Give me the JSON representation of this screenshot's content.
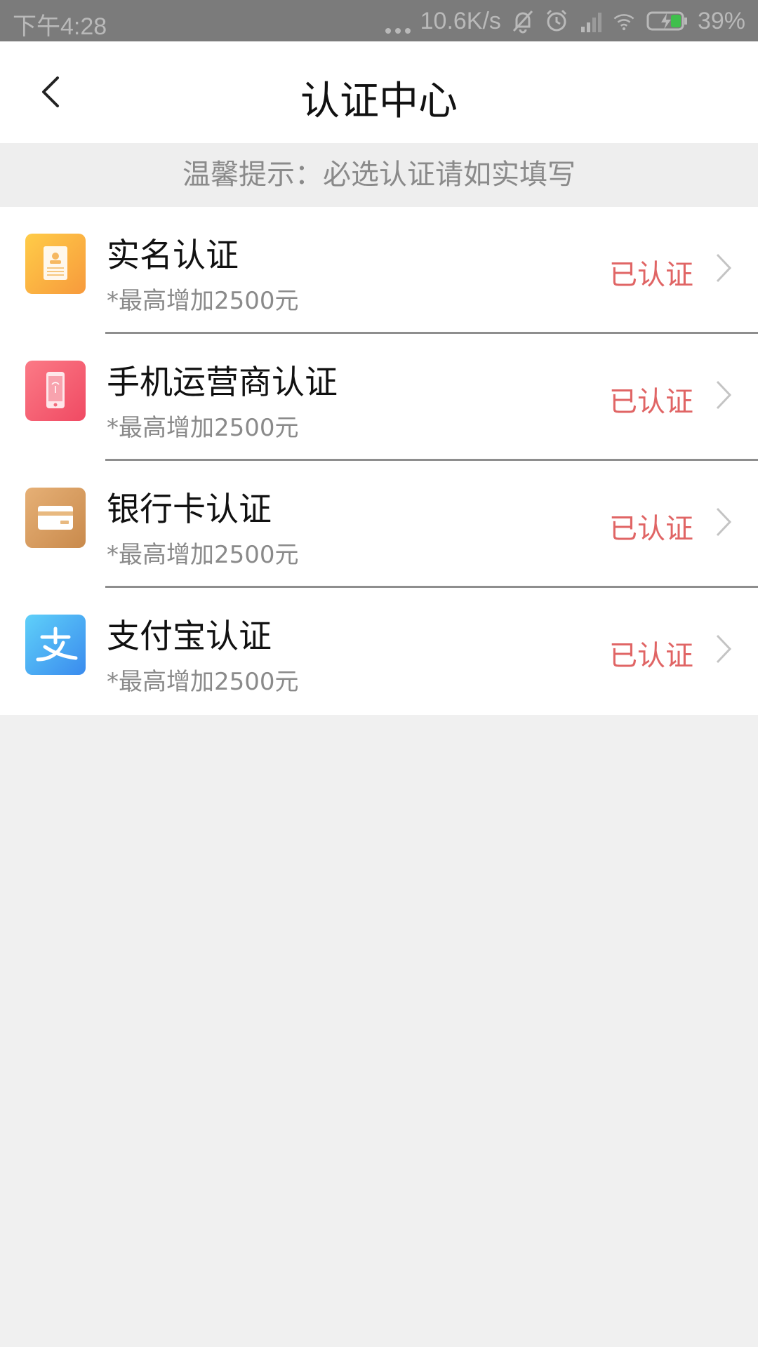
{
  "status_bar": {
    "time": "下午4:28",
    "network_speed": "10.6K/s",
    "battery": "39%"
  },
  "header": {
    "title": "认证中心"
  },
  "tip": {
    "text": "温馨提示：必选认证请如实填写"
  },
  "items": [
    {
      "title": "实名认证",
      "subtitle": "*最高增加2500元",
      "status": "已认证",
      "icon": "id-card-icon",
      "icon_colors": [
        "#ffcc48",
        "#f79a3c"
      ]
    },
    {
      "title": "手机运营商认证",
      "subtitle": "*最高增加2500元",
      "status": "已认证",
      "icon": "mobile-phone-icon",
      "icon_colors": [
        "#fb7a86",
        "#f04a63"
      ]
    },
    {
      "title": "银行卡认证",
      "subtitle": "*最高增加2500元",
      "status": "已认证",
      "icon": "bank-card-icon",
      "icon_colors": [
        "#e6b076",
        "#c98a4c"
      ]
    },
    {
      "title": "支付宝认证",
      "subtitle": "*最高增加2500元",
      "status": "已认证",
      "icon": "alipay-icon",
      "icon_colors": [
        "#5fd0f9",
        "#3a8bee"
      ]
    }
  ],
  "colors": {
    "status_text": "#e06565",
    "page_background": "#f0f0f0",
    "status_bar_background": "#7b7b7b"
  }
}
